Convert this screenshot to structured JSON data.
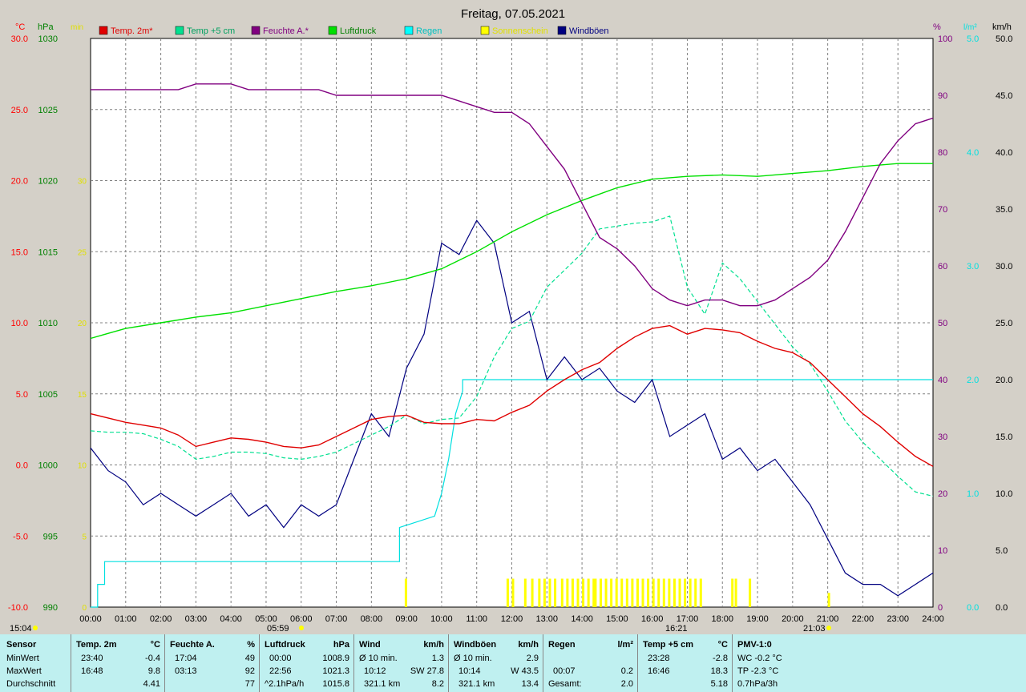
{
  "title": "Freitag, 07.05.2021",
  "axes": {
    "temp": {
      "unit": "°C",
      "ticks": [
        "30.0",
        "25.0",
        "20.0",
        "15.0",
        "10.0",
        "5.0",
        "0.0",
        "-5.0",
        "-10.0"
      ],
      "color": "#ff0000"
    },
    "pressure": {
      "unit": "hPa",
      "ticks": [
        "1030",
        "1025",
        "1020",
        "1015",
        "1010",
        "1005",
        "1000",
        "995",
        "990"
      ],
      "color": "#00c000"
    },
    "sunshine": {
      "unit": "min",
      "ticks": [
        "30",
        "25",
        "20",
        "15",
        "10",
        "5",
        "0"
      ],
      "color": "#ffff00"
    },
    "humidity": {
      "unit": "%",
      "ticks": [
        "100",
        "90",
        "80",
        "70",
        "60",
        "50",
        "40",
        "30",
        "20",
        "10",
        "0"
      ],
      "color": "#800080"
    },
    "rain": {
      "unit": "l/m²",
      "ticks": [
        "5.0",
        "4.0",
        "3.0",
        "2.0",
        "1.0",
        "0.0"
      ],
      "color": "#00e0e0"
    },
    "wind": {
      "unit": "km/h",
      "ticks": [
        "50.0",
        "45.0",
        "40.0",
        "35.0",
        "30.0",
        "25.0",
        "20.0",
        "15.0",
        "10.0",
        "5.0",
        "0.0"
      ],
      "color": "#000080"
    }
  },
  "legend": [
    {
      "label": "Temp. 2m*",
      "color": "#e00000",
      "text_color": "#e00000"
    },
    {
      "label": "Temp +5 cm",
      "color": "#00e090",
      "text_color": "#00a060"
    },
    {
      "label": "Feuchte A.*",
      "color": "#800080",
      "text_color": "#800080"
    },
    {
      "label": "Luftdruck",
      "color": "#00e000",
      "text_color": "#008000"
    },
    {
      "label": "Regen",
      "color": "#00ffff",
      "text_color": "#00c0c0"
    },
    {
      "label": "Sonnenschein",
      "color": "#ffff00",
      "text_color": "#e0e000"
    },
    {
      "label": "Windböen",
      "color": "#000080",
      "text_color": "#000080"
    }
  ],
  "x_ticks": [
    "00:00",
    "01:00",
    "02:00",
    "03:00",
    "04:00",
    "05:00",
    "06:00",
    "07:00",
    "08:00",
    "09:00",
    "10:00",
    "11:00",
    "12:00",
    "13:00",
    "14:00",
    "15:00",
    "16:00",
    "17:00",
    "18:00",
    "19:00",
    "20:00",
    "21:00",
    "22:00",
    "23:00",
    "24:00"
  ],
  "markers": {
    "min_temp_time": "05:59",
    "max_temp_time": "16:21",
    "sunrise_label": "15:04",
    "sunset_label": "21:03"
  },
  "chart_data": {
    "type": "line",
    "title": "Freitag, 07.05.2021",
    "x_range_hours": [
      0,
      24
    ],
    "series": [
      {
        "name": "Temp. 2m*",
        "unit": "°C",
        "ylim": [
          -10,
          30
        ],
        "x": [
          0,
          0.5,
          1,
          1.5,
          2,
          2.5,
          3,
          3.5,
          4,
          4.5,
          5,
          5.5,
          6,
          6.5,
          7,
          7.5,
          8,
          8.5,
          9,
          9.5,
          10,
          10.5,
          11,
          11.5,
          12,
          12.5,
          13,
          13.5,
          14,
          14.5,
          15,
          15.5,
          16,
          16.5,
          17,
          17.5,
          18,
          18.5,
          19,
          19.5,
          20,
          20.5,
          21,
          21.5,
          22,
          22.5,
          23,
          23.5,
          24
        ],
        "y": [
          3.6,
          3.3,
          3.0,
          2.8,
          2.6,
          2.1,
          1.3,
          1.6,
          1.9,
          1.8,
          1.6,
          1.3,
          1.2,
          1.4,
          2.0,
          2.6,
          3.2,
          3.4,
          3.5,
          3.0,
          2.9,
          2.9,
          3.2,
          3.1,
          3.7,
          4.2,
          5.2,
          6.0,
          6.7,
          7.2,
          8.2,
          9.0,
          9.6,
          9.8,
          9.2,
          9.6,
          9.5,
          9.3,
          8.7,
          8.2,
          7.9,
          7.2,
          6.0,
          4.8,
          3.6,
          2.7,
          1.6,
          0.6,
          -0.1
        ]
      },
      {
        "name": "Temp +5 cm",
        "unit": "°C",
        "ylim": [
          -10,
          30
        ],
        "x": [
          0,
          0.5,
          1,
          1.5,
          2,
          2.5,
          3,
          3.5,
          4,
          4.5,
          5,
          5.5,
          6,
          6.5,
          7,
          7.5,
          8,
          8.5,
          9,
          9.5,
          10,
          10.5,
          11,
          11.5,
          12,
          12.5,
          13,
          13.5,
          14,
          14.5,
          15,
          15.5,
          16,
          16.5,
          17,
          17.5,
          18,
          18.5,
          19,
          19.5,
          20,
          20.5,
          21,
          21.5,
          22,
          22.5,
          23,
          23.5,
          24
        ],
        "y": [
          2.4,
          2.3,
          2.3,
          2.2,
          1.8,
          1.3,
          0.4,
          0.6,
          0.9,
          0.9,
          0.8,
          0.5,
          0.4,
          0.6,
          0.9,
          1.5,
          2.1,
          2.7,
          3.5,
          2.9,
          3.2,
          3.3,
          4.8,
          7.6,
          9.6,
          10.1,
          12.5,
          13.7,
          14.9,
          16.6,
          16.8,
          17.0,
          17.1,
          17.5,
          12.5,
          10.6,
          14.2,
          13.1,
          11.5,
          9.9,
          8.3,
          7.1,
          5.2,
          3.1,
          1.6,
          0.4,
          -0.8,
          -1.9,
          -2.2
        ]
      },
      {
        "name": "Feuchte A.*",
        "unit": "%",
        "ylim": [
          0,
          100
        ],
        "x": [
          0,
          0.5,
          1,
          1.5,
          2,
          2.5,
          3,
          3.5,
          4,
          4.5,
          5,
          5.5,
          6,
          6.5,
          7,
          7.5,
          8,
          8.5,
          9,
          9.5,
          10,
          10.5,
          11,
          11.5,
          12,
          12.5,
          13,
          13.5,
          14,
          14.5,
          15,
          15.5,
          16,
          16.5,
          17,
          17.5,
          18,
          18.5,
          19,
          19.5,
          20,
          20.5,
          21,
          21.5,
          22,
          22.5,
          23,
          23.5,
          24
        ],
        "y": [
          91,
          91,
          91,
          91,
          91,
          91,
          92,
          92,
          92,
          91,
          91,
          91,
          91,
          91,
          90,
          90,
          90,
          90,
          90,
          90,
          90,
          89,
          88,
          87,
          87,
          85,
          81,
          77,
          71,
          65,
          63,
          60,
          56,
          54,
          53,
          54,
          54,
          53,
          53,
          54,
          56,
          58,
          61,
          66,
          72,
          78,
          82,
          85,
          86
        ]
      },
      {
        "name": "Luftdruck",
        "unit": "hPa",
        "ylim": [
          990,
          1030
        ],
        "x": [
          0,
          1,
          2,
          3,
          4,
          5,
          6,
          7,
          8,
          9,
          10,
          11,
          12,
          13,
          14,
          15,
          16,
          17,
          18,
          19,
          20,
          21,
          22,
          23,
          24
        ],
        "y": [
          1008.9,
          1009.6,
          1010.0,
          1010.4,
          1010.7,
          1011.2,
          1011.7,
          1012.2,
          1012.6,
          1013.1,
          1013.8,
          1015.0,
          1016.4,
          1017.6,
          1018.6,
          1019.5,
          1020.1,
          1020.3,
          1020.4,
          1020.3,
          1020.5,
          1020.7,
          1021.0,
          1021.2,
          1021.2
        ]
      },
      {
        "name": "Regen",
        "unit": "l/m²",
        "ylim": [
          0,
          5
        ],
        "x": [
          0,
          0.2,
          0.2,
          0.4,
          0.4,
          8.8,
          8.8,
          9.8,
          10.0,
          10.2,
          10.4,
          10.6,
          10.6,
          24
        ],
        "y": [
          0,
          0,
          0.2,
          0.2,
          0.4,
          0.4,
          0.7,
          0.8,
          1.0,
          1.3,
          1.7,
          1.9,
          2.0,
          2.0
        ]
      },
      {
        "name": "Windböen",
        "unit": "km/h",
        "ylim": [
          0,
          50
        ],
        "x": [
          0,
          0.5,
          1,
          1.5,
          2,
          2.5,
          3,
          3.5,
          4,
          4.5,
          5,
          5.5,
          6,
          6.5,
          7,
          7.5,
          8,
          8.5,
          9,
          9.5,
          10,
          10.5,
          11,
          11.5,
          12,
          12.5,
          13,
          13.5,
          14,
          14.5,
          15,
          15.5,
          16,
          16.5,
          17,
          17.5,
          18,
          18.5,
          19,
          19.5,
          20,
          20.5,
          21,
          21.5,
          22,
          22.5,
          23,
          23.5,
          24
        ],
        "y": [
          14,
          12,
          11,
          9,
          10,
          9,
          8,
          9,
          10,
          8,
          9,
          7,
          9,
          8,
          9,
          13,
          17,
          15,
          21,
          24,
          32,
          31,
          34,
          32,
          25,
          26,
          20,
          22,
          20,
          21,
          19,
          18,
          20,
          15,
          16,
          17,
          13,
          14,
          12,
          13,
          11,
          9,
          6,
          3,
          2,
          2,
          1,
          2,
          3
        ]
      },
      {
        "name": "Sonnenschein",
        "unit": "min",
        "ylim": [
          0,
          30
        ],
        "bars_x": [
          8.95,
          11.85,
          12.0,
          12.35,
          12.55,
          12.75,
          12.9,
          13.05,
          13.2,
          13.4,
          13.55,
          13.7,
          13.85,
          14.0,
          14.15,
          14.3,
          14.35,
          14.5,
          14.65,
          14.8,
          14.95,
          15.1,
          15.25,
          15.4,
          15.55,
          15.7,
          15.85,
          16.0,
          16.15,
          16.3,
          16.45,
          16.6,
          16.75,
          16.9,
          17.05,
          17.2,
          17.35,
          18.25,
          18.35,
          18.75,
          21.0
        ],
        "bars_y": [
          2,
          2,
          2,
          2,
          2,
          2,
          2,
          2,
          2,
          2,
          2,
          2,
          2,
          2,
          2,
          2,
          2,
          2,
          2,
          2,
          2,
          2,
          2,
          2,
          2,
          2,
          2,
          2,
          2,
          2,
          2,
          2,
          2,
          2,
          2,
          2,
          2,
          2,
          2,
          2,
          1
        ]
      }
    ]
  },
  "stats": {
    "sensor": {
      "header": "Sensor",
      "rows": [
        "MinWert",
        "MaxWert",
        "Durchschnitt"
      ]
    },
    "temp2m": {
      "header": "Temp. 2m",
      "unit": "°C",
      "rows": [
        [
          "23:40",
          "-0.4"
        ],
        [
          "16:48",
          "9.8"
        ],
        [
          "",
          "4.41"
        ]
      ]
    },
    "feuchte": {
      "header": "Feuchte A.",
      "unit": "%",
      "rows": [
        [
          "17:04",
          "49"
        ],
        [
          "03:13",
          "92"
        ],
        [
          "",
          "77"
        ]
      ]
    },
    "luftdruck": {
      "header": "Luftdruck",
      "unit": "hPa",
      "rows": [
        [
          "00:00",
          "1008.9"
        ],
        [
          "22:56",
          "1021.3"
        ],
        [
          "^2.1hPa/h",
          "1015.8"
        ]
      ]
    },
    "wind": {
      "header": "Wind",
      "unit": "km/h",
      "rows": [
        [
          "Ø 10 min.",
          "1.3"
        ],
        [
          "10:12",
          "SW 27.8"
        ],
        [
          "321.1 km",
          "8.2"
        ]
      ]
    },
    "windboeen": {
      "header": "Windböen",
      "unit": "km/h",
      "rows": [
        [
          "Ø 10 min.",
          "2.9"
        ],
        [
          "10:14",
          "W 43.5"
        ],
        [
          "321.1 km",
          "13.4"
        ]
      ]
    },
    "regen": {
      "header": "Regen",
      "unit": "l/m²",
      "rows": [
        [
          "",
          ""
        ],
        [
          "00:07",
          "0.2"
        ],
        [
          "Gesamt:",
          "2.0"
        ]
      ]
    },
    "temp5cm": {
      "header": "Temp +5 cm",
      "unit": "°C",
      "rows": [
        [
          "23:28",
          "-2.8"
        ],
        [
          "16:46",
          "18.3"
        ],
        [
          "",
          "5.18"
        ]
      ]
    },
    "pmv": {
      "header": "PMV-1:0",
      "rows": [
        "WC -0.2 °C",
        "TP -2.3 °C",
        "0.7hPa/3h"
      ]
    }
  }
}
